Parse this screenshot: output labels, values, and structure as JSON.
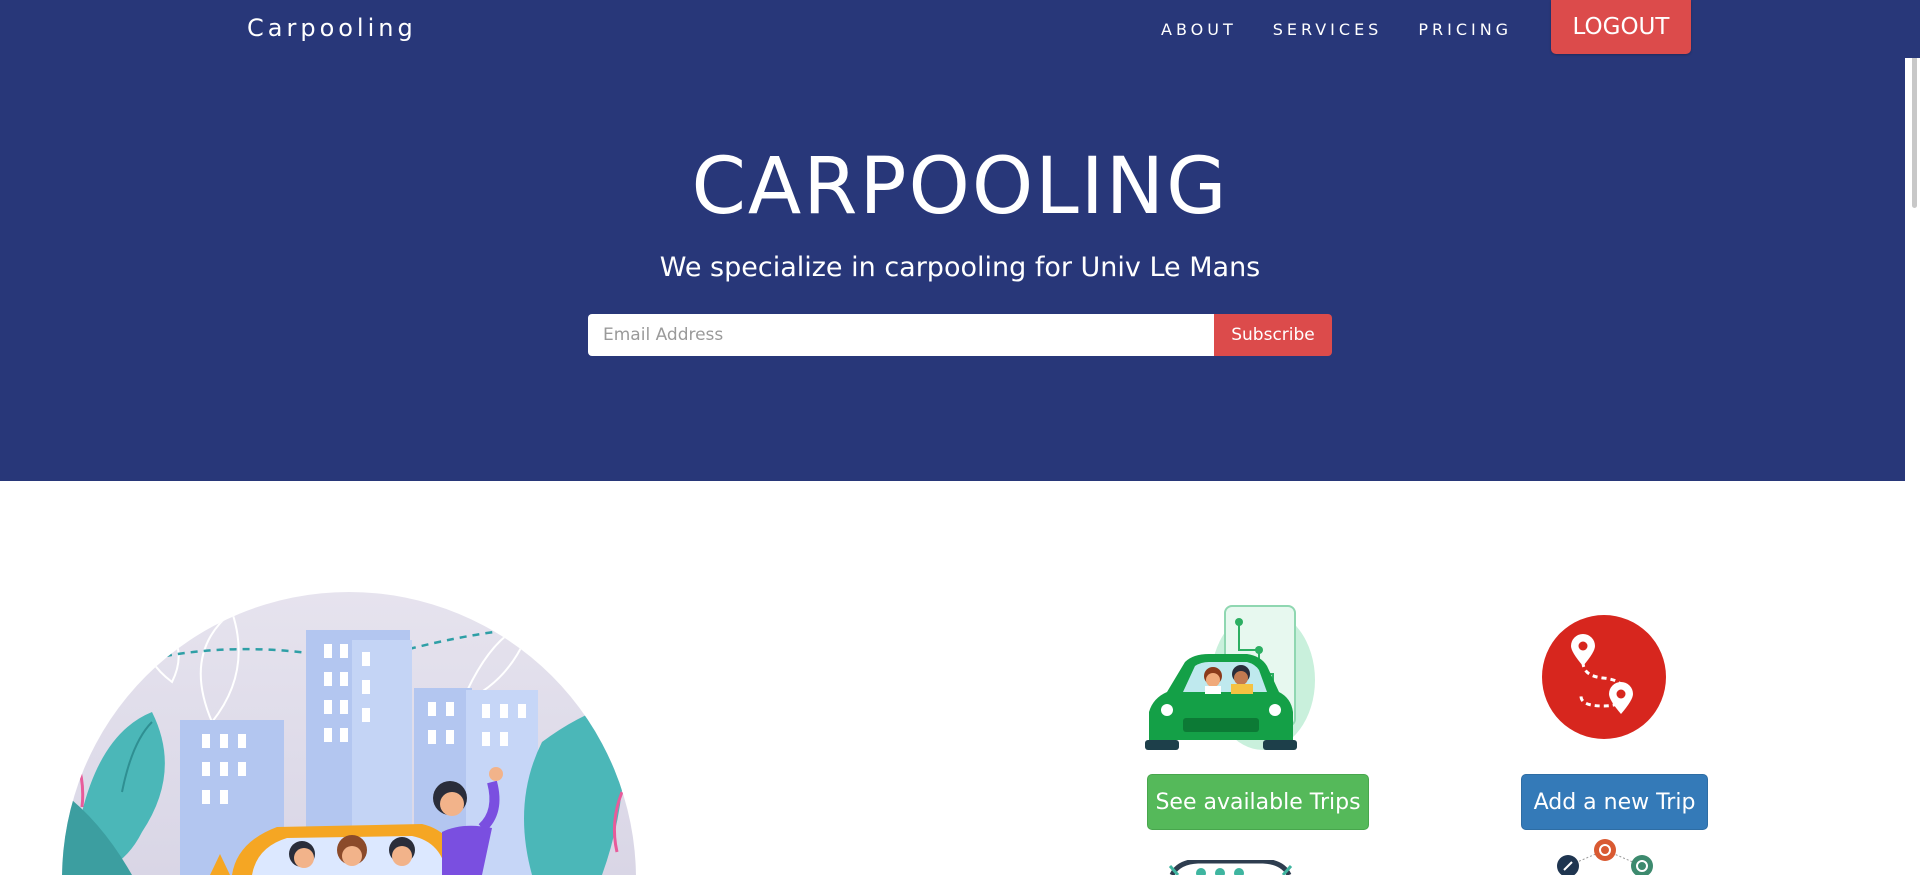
{
  "nav": {
    "brand": "Carpooling",
    "links": [
      "ABOUT",
      "SERVICES",
      "PRICING"
    ],
    "logout_label": "LOGOUT"
  },
  "hero": {
    "title": "CARPOOLING",
    "subtitle": "We specialize in carpooling for Univ Le Mans",
    "email_placeholder": "Email Address",
    "subscribe_label": "Subscribe"
  },
  "actions": {
    "see_trips_label": "See available Trips",
    "add_trip_label": "Add a new Trip"
  },
  "colors": {
    "nav_bg": "#283779",
    "accent_red": "#dc4b4b",
    "green": "#55b95a",
    "blue": "#347ab8"
  },
  "icons": [
    "carpool-city-illustration",
    "car-app-illustration",
    "route-pin-icon"
  ]
}
